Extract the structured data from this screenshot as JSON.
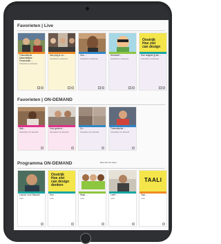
{
  "sections": {
    "live": {
      "title": "Favorieten | Live"
    },
    "ondemand": {
      "title": "Favorieten | ON-DEMAND"
    },
    "programma": {
      "title": "Programma ON-DEMAND",
      "link": "Meer dan rest stress"
    }
  },
  "live_cards": [
    {
      "title": "Thematische Maandelijkse Presentatie ...",
      "sub": "Interactief | Livestream"
    },
    {
      "title": "Van jong & zo...",
      "sub": "Interactief | Livestream"
    },
    {
      "title": "Ons ...",
      "sub": "Interactief | Livestream"
    },
    {
      "title": "Herinnert ...",
      "sub": "Interactief | Livestream"
    },
    {
      "title": "Hoe reageer jij als ...",
      "sub": "Interactief | Livestream"
    }
  ],
  "ondemand_cards": [
    {
      "title": "Wat ...",
      "sub": "Interactief | On-demand"
    },
    {
      "title": "Snel geleerd ...",
      "sub": "Interactief | On-demand"
    },
    {
      "title": "Zo ...",
      "sub": "Interactief | On-demand"
    },
    {
      "title": "Thematische ...",
      "sub": "Interactief | On-demand"
    }
  ],
  "programma_cards": [
    {
      "title": "Lesson Lea Ostauxin",
      "sub": "Leeft"
    },
    {
      "title": "Hoe ...",
      "sub": "Leeft"
    },
    {
      "title": "Waar ...",
      "sub": "Leeft"
    },
    {
      "title": "Leeft ...",
      "sub": "Leeft"
    },
    {
      "title": "Taal ...",
      "sub": "Leeft"
    }
  ],
  "thumb_texts": {
    "design_line1": "Oostrijk",
    "design_line2": "Hoe ziet",
    "design_line3": "can design",
    "design_line4": "denken",
    "taali": "TAALI"
  },
  "colors": {
    "orange": "#f08a24",
    "pink": "#e0318a",
    "blue": "#2f86c8",
    "green": "#8dc63f",
    "teal": "#16a6a0",
    "yellow_thumb": "#f4e64a"
  }
}
